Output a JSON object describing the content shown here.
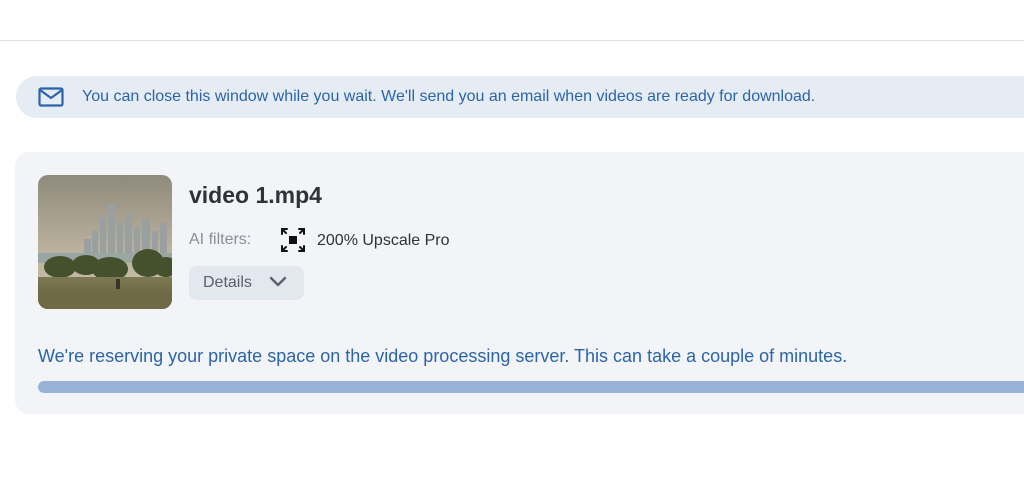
{
  "notice": {
    "icon": "mail-icon",
    "text": "You can close this window while you wait. We'll send you an email when videos are ready for download."
  },
  "job": {
    "file_name": "video 1.mp4",
    "thumbnail": "city-skyline-park-thumbnail",
    "filters_label": "AI filters:",
    "filter_icon": "upscale-expand-icon",
    "filter_name": "200% Upscale Pro",
    "details_label": "Details",
    "details_icon": "chevron-down-icon",
    "status_text": "We're reserving your private space on the video processing server. This can take a couple of minutes.",
    "progress": 1.0
  },
  "colors": {
    "accent_text": "#2b64a8",
    "notice_bg": "#e6ecf4",
    "card_bg": "#f2f4f7",
    "progress_fill": "#96b3d6"
  }
}
